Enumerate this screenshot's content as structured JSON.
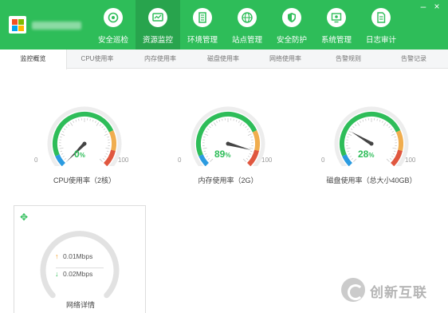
{
  "colors": {
    "brand_green": "#2ebd59",
    "gauge_blue": "#2b9be0",
    "gauge_orange": "#f0ad4e",
    "gauge_red": "#e0573f"
  },
  "nav": {
    "items": [
      {
        "label": "安全巡检",
        "icon": "shield-scan-icon"
      },
      {
        "label": "资源监控",
        "icon": "monitor-icon",
        "active": true
      },
      {
        "label": "环境管理",
        "icon": "server-icon"
      },
      {
        "label": "站点管理",
        "icon": "globe-icon"
      },
      {
        "label": "安全防护",
        "icon": "shield-icon"
      },
      {
        "label": "系统管理",
        "icon": "settings-monitor-icon"
      },
      {
        "label": "日志审计",
        "icon": "document-icon"
      }
    ]
  },
  "window": {
    "minimize": "–",
    "close": "×"
  },
  "tabs": [
    {
      "label": "监控概览",
      "active": true
    },
    {
      "label": "CPU使用率"
    },
    {
      "label": "内存使用率"
    },
    {
      "label": "磁盘使用率"
    },
    {
      "label": "网络使用率"
    },
    {
      "label": "告警规则"
    },
    {
      "label": "告警记录"
    }
  ],
  "gauges": [
    {
      "value": 0,
      "display": "0",
      "unit": "%",
      "min": "0",
      "max": "100",
      "label": "CPU使用率（2核）"
    },
    {
      "value": 89,
      "display": "89",
      "unit": "%",
      "min": "0",
      "max": "100",
      "label": "内存使用率（2G）"
    },
    {
      "value": 28,
      "display": "28",
      "unit": "%",
      "min": "0",
      "max": "100",
      "label": "磁盘使用率（总大小40GB）"
    }
  ],
  "network": {
    "upload": "0.01Mbps",
    "download": "0.02Mbps",
    "label": "网络详情",
    "up_arrow": "↑",
    "down_arrow": "↓",
    "move_icon": "✥"
  },
  "watermark": {
    "text": "创新互联"
  }
}
